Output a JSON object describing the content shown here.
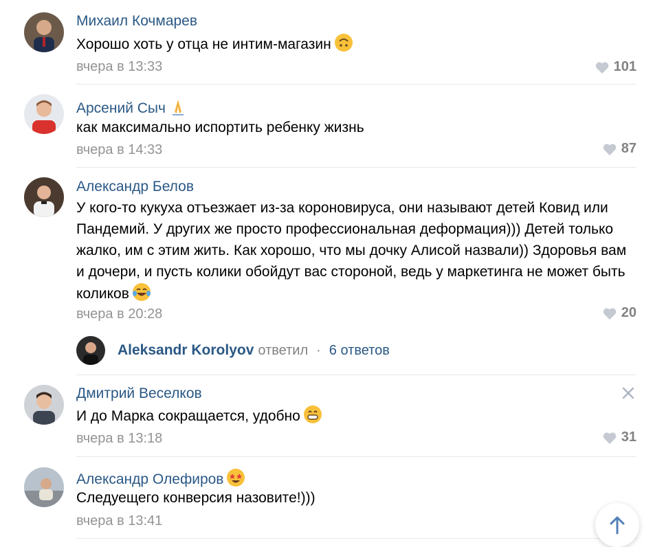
{
  "comments": [
    {
      "author": "Михаил Кочмарев",
      "text": "Хорошо хоть у отца не интим-магазин",
      "emoji": "upside-down-face-icon",
      "date": "вчера в 13:33",
      "likes": "101"
    },
    {
      "author": "Арсений Сыч",
      "author_emoji": "folded-hands-icon",
      "text": "как максимально испортить ребенку жизнь",
      "date": "вчера в 14:33",
      "likes": "87"
    },
    {
      "author": "Александр Белов",
      "text": "У кого-то кукуха отъезжает из-за короновируса, они называют детей Ковид или Пандемий. У других же просто профессиональная деформация))) Детей только жалко, им с этим жить. Как хорошо, что мы дочку Алисой назвали)) Здоровья вам и дочери, и пусть колики обойдут вас стороной, ведь у маркетинга не может быть коликов",
      "emoji": "tears-of-joy-icon",
      "date": "вчера в 20:28",
      "likes": "20"
    },
    {
      "author": "Дмитрий Веселков",
      "text": "И до Марка сокращается, удобно",
      "emoji": "grinning-face-icon",
      "date": "вчера в 13:18",
      "likes": "31"
    },
    {
      "author": "Александр Олефиров",
      "author_emoji": "star-struck-icon",
      "text": "Следуещего конверсия назовите!)))",
      "date": "вчера в 13:41"
    }
  ],
  "reply": {
    "name": "Aleksandr Korolyov",
    "verb": "ответил",
    "separator": "·",
    "count": "6 ответов"
  },
  "colors": {
    "link": "#2a5885",
    "muted": "#939393",
    "likes": "#828282",
    "separator": "#e7e8ec"
  }
}
